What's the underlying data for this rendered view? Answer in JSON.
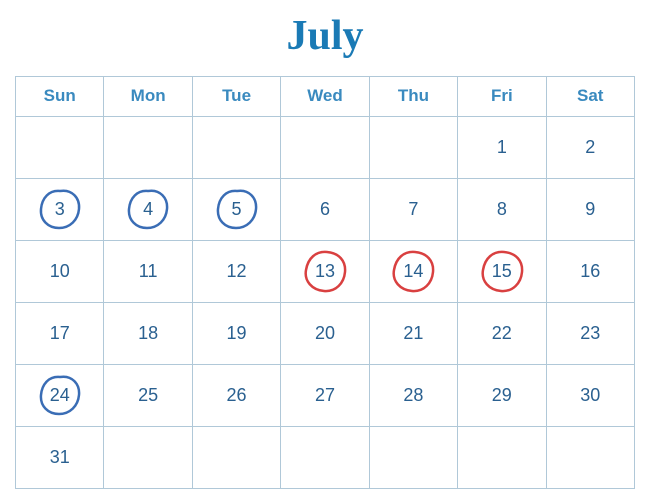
{
  "calendar": {
    "title": "July",
    "day_names": [
      "Sun",
      "Mon",
      "Tue",
      "Wed",
      "Thu",
      "Fri",
      "Sat"
    ],
    "weeks": [
      [
        {
          "day": "",
          "circle": null
        },
        {
          "day": "",
          "circle": null
        },
        {
          "day": "",
          "circle": null
        },
        {
          "day": "",
          "circle": null
        },
        {
          "day": "",
          "circle": null
        },
        {
          "day": "1",
          "circle": null
        },
        {
          "day": "2",
          "circle": null
        }
      ],
      [
        {
          "day": "3",
          "circle": "blue"
        },
        {
          "day": "4",
          "circle": "blue"
        },
        {
          "day": "5",
          "circle": "blue"
        },
        {
          "day": "6",
          "circle": null
        },
        {
          "day": "7",
          "circle": null
        },
        {
          "day": "8",
          "circle": null
        },
        {
          "day": "9",
          "circle": null
        }
      ],
      [
        {
          "day": "10",
          "circle": null
        },
        {
          "day": "11",
          "circle": null
        },
        {
          "day": "12",
          "circle": null
        },
        {
          "day": "13",
          "circle": "red"
        },
        {
          "day": "14",
          "circle": "red"
        },
        {
          "day": "15",
          "circle": "red"
        },
        {
          "day": "16",
          "circle": null
        }
      ],
      [
        {
          "day": "17",
          "circle": null
        },
        {
          "day": "18",
          "circle": null
        },
        {
          "day": "19",
          "circle": null
        },
        {
          "day": "20",
          "circle": null
        },
        {
          "day": "21",
          "circle": null
        },
        {
          "day": "22",
          "circle": null
        },
        {
          "day": "23",
          "circle": null
        }
      ],
      [
        {
          "day": "24",
          "circle": "blue"
        },
        {
          "day": "25",
          "circle": null
        },
        {
          "day": "26",
          "circle": null
        },
        {
          "day": "27",
          "circle": null
        },
        {
          "day": "28",
          "circle": null
        },
        {
          "day": "29",
          "circle": null
        },
        {
          "day": "30",
          "circle": null
        }
      ],
      [
        {
          "day": "31",
          "circle": null
        },
        {
          "day": "",
          "circle": null
        },
        {
          "day": "",
          "circle": null
        },
        {
          "day": "",
          "circle": null
        },
        {
          "day": "",
          "circle": null
        },
        {
          "day": "",
          "circle": null
        },
        {
          "day": "",
          "circle": null
        }
      ]
    ]
  }
}
